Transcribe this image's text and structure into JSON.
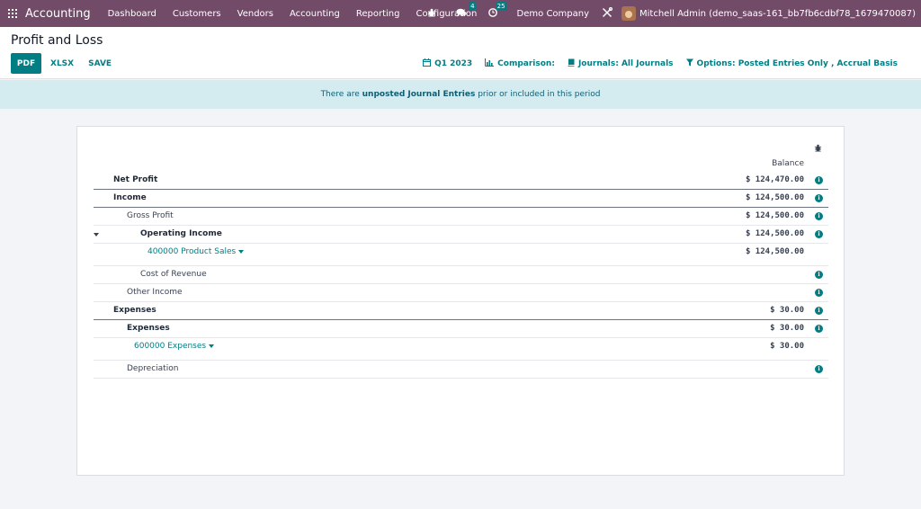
{
  "navbar": {
    "app_name": "Accounting",
    "menu": [
      "Dashboard",
      "Customers",
      "Vendors",
      "Accounting",
      "Reporting",
      "Configuration"
    ],
    "messages_count": "4",
    "activities_count": "25",
    "company": "Demo Company",
    "user": "Mitchell Admin (demo_saas-161_bb7fb6cdbf78_1679470087)",
    "icons": [
      "apps-icon",
      "bug-icon",
      "chat-icon",
      "clock-icon",
      "tools-icon"
    ]
  },
  "control": {
    "title": "Profit and Loss",
    "buttons": {
      "pdf": "PDF",
      "xlsx": "XLSX",
      "save": "SAVE"
    },
    "filters": {
      "period": "Q1 2023",
      "comparison": "Comparison:",
      "journals": "Journals: All Journals",
      "options": "Options: Posted Entries Only , Accrual Basis"
    }
  },
  "alert": {
    "prefix": "There are ",
    "link": "unposted Journal Entries",
    "suffix": " prior or included in this period"
  },
  "report": {
    "column_header": "Balance",
    "rows": [
      {
        "label": "Net Profit",
        "amount": "$ 124,470.00"
      },
      {
        "label": "Income",
        "amount": "$ 124,500.00"
      },
      {
        "label": "Gross Profit",
        "amount": "$ 124,500.00"
      },
      {
        "label": "Operating Income",
        "amount": "$ 124,500.00"
      },
      {
        "label": "400000 Product Sales",
        "amount": "$ 124,500.00"
      },
      {
        "label": "Cost of Revenue",
        "amount": ""
      },
      {
        "label": "Other Income",
        "amount": ""
      },
      {
        "label": "Expenses",
        "amount": "$ 30.00"
      },
      {
        "label": "Expenses",
        "amount": "$ 30.00"
      },
      {
        "label": "600000 Expenses",
        "amount": "$ 30.00"
      },
      {
        "label": "Depreciation",
        "amount": ""
      }
    ]
  },
  "colors": {
    "navbar": "#714b67",
    "accent": "#017e84",
    "alert_bg": "#d4ecf0"
  }
}
